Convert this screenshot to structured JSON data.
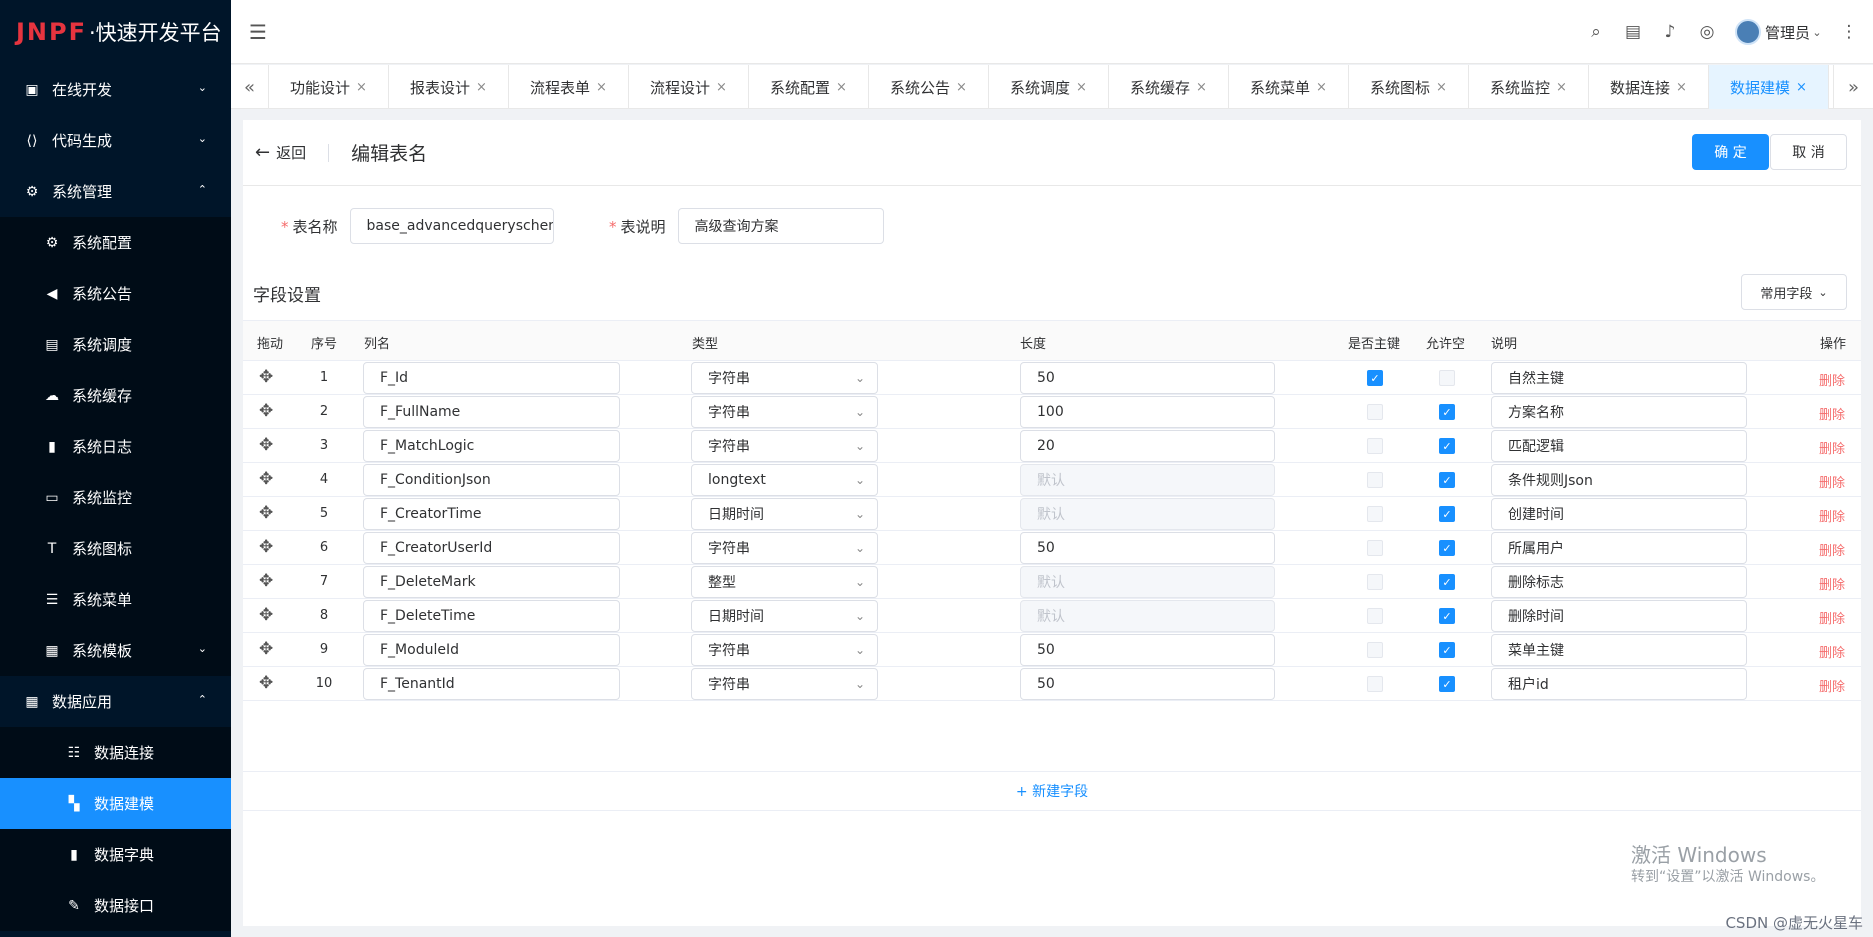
{
  "logo": {
    "brand": "JNPF",
    "text": "·快速开发平台"
  },
  "sidebar": {
    "items": [
      {
        "label": "在线开发",
        "chev": "⌄"
      },
      {
        "label": "代码生成",
        "chev": "⌄"
      },
      {
        "label": "系统管理",
        "chev": "⌃"
      },
      {
        "label": "系统配置"
      },
      {
        "label": "系统公告"
      },
      {
        "label": "系统调度"
      },
      {
        "label": "系统缓存"
      },
      {
        "label": "系统日志"
      },
      {
        "label": "系统监控"
      },
      {
        "label": "系统图标"
      },
      {
        "label": "系统菜单"
      },
      {
        "label": "系统模板",
        "chev": "⌄"
      },
      {
        "label": "数据应用",
        "chev": "⌃"
      },
      {
        "label": "数据连接"
      },
      {
        "label": "数据建模"
      },
      {
        "label": "数据字典"
      },
      {
        "label": "数据接口"
      }
    ]
  },
  "header": {
    "username": "管理员"
  },
  "tabs": [
    "功能设计",
    "报表设计",
    "流程表单",
    "流程设计",
    "系统配置",
    "系统公告",
    "系统调度",
    "系统缓存",
    "系统菜单",
    "系统图标",
    "系统监控",
    "数据连接",
    "数据建模"
  ],
  "page": {
    "back": "返回",
    "title": "编辑表名",
    "confirm": "确 定",
    "cancel": "取 消",
    "table_name_label": "表名称",
    "table_name_value": "base_advancedqueryschem",
    "table_desc_label": "表说明",
    "table_desc_value": "高级查询方案",
    "section_title": "字段设置",
    "common_fields": "常用字段",
    "add_field": "+ 新建字段"
  },
  "columns": [
    "拖动",
    "序号",
    "列名",
    "类型",
    "长度",
    "是否主键",
    "允许空",
    "说明",
    "操作"
  ],
  "rows": [
    {
      "idx": "1",
      "name": "F_Id",
      "type": "字符串",
      "length": "50",
      "pk": true,
      "nullable": false,
      "desc": "自然主键"
    },
    {
      "idx": "2",
      "name": "F_FullName",
      "type": "字符串",
      "length": "100",
      "pk": false,
      "nullable": true,
      "desc": "方案名称"
    },
    {
      "idx": "3",
      "name": "F_MatchLogic",
      "type": "字符串",
      "length": "20",
      "pk": false,
      "nullable": true,
      "desc": "匹配逻辑"
    },
    {
      "idx": "4",
      "name": "F_ConditionJson",
      "type": "longtext",
      "length": "默认",
      "pk": false,
      "nullable": true,
      "desc": "条件规则Json"
    },
    {
      "idx": "5",
      "name": "F_CreatorTime",
      "type": "日期时间",
      "length": "默认",
      "pk": false,
      "nullable": true,
      "desc": "创建时间"
    },
    {
      "idx": "6",
      "name": "F_CreatorUserId",
      "type": "字符串",
      "length": "50",
      "pk": false,
      "nullable": true,
      "desc": "所属用户"
    },
    {
      "idx": "7",
      "name": "F_DeleteMark",
      "type": "整型",
      "length": "默认",
      "pk": false,
      "nullable": true,
      "desc": "删除标志"
    },
    {
      "idx": "8",
      "name": "F_DeleteTime",
      "type": "日期时间",
      "length": "默认",
      "pk": false,
      "nullable": true,
      "desc": "删除时间"
    },
    {
      "idx": "9",
      "name": "F_ModuleId",
      "type": "字符串",
      "length": "50",
      "pk": false,
      "nullable": true,
      "desc": "菜单主键"
    },
    {
      "idx": "10",
      "name": "F_TenantId",
      "type": "字符串",
      "length": "50",
      "pk": false,
      "nullable": true,
      "desc": "租户id"
    }
  ],
  "delete_label": "删除",
  "watermark": {
    "line1": "激活 Windows",
    "line2": "转到“设置”以激活 Windows。",
    "csdn": "CSDN @虚无火星车"
  }
}
